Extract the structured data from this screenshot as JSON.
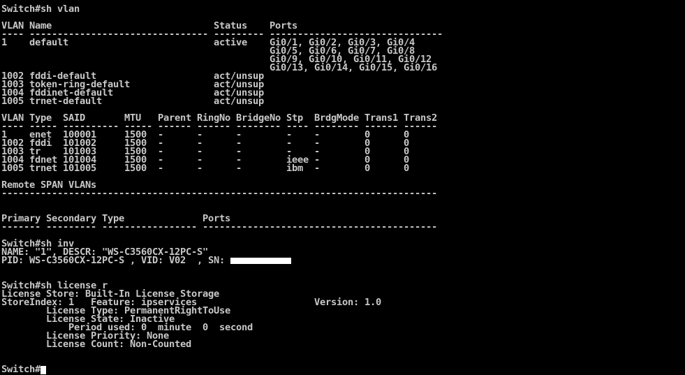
{
  "terminal": {
    "lines": [
      "Switch#sh vlan",
      "",
      "VLAN Name                             Status    Ports",
      "---- -------------------------------- --------- -------------------------------",
      "1    default                          active    Gi0/1, Gi0/2, Gi0/3, Gi0/4",
      "                                                Gi0/5, Gi0/6, Gi0/7, Gi0/8",
      "                                                Gi0/9, Gi0/10, Gi0/11, Gi0/12",
      "                                                Gi0/13, Gi0/14, Gi0/15, Gi0/16",
      "1002 fddi-default                     act/unsup",
      "1003 token-ring-default               act/unsup",
      "1004 fddinet-default                  act/unsup",
      "1005 trnet-default                    act/unsup",
      "",
      "VLAN Type  SAID       MTU   Parent RingNo BridgeNo Stp  BrdgMode Trans1 Trans2",
      "---- ----- ---------- ----- ------ ------ -------- ---- -------- ------ ------",
      "1    enet  100001     1500  -      -      -        -    -        0      0",
      "1002 fddi  101002     1500  -      -      -        -    -        0      0",
      "1003 tr    101003     1500  -      -      -        -    -        0      0",
      "1004 fdnet 101004     1500  -      -      -        ieee -        0      0",
      "1005 trnet 101005     1500  -      -      -        ibm  -        0      0",
      "",
      "Remote SPAN VLANs",
      "------------------------------------------------------------------------------",
      "",
      "",
      "Primary Secondary Type              Ports",
      "------- --------- ----------------- ------------------------------------------",
      "",
      "Switch#sh inv",
      "NAME: \"1\", DESCR: \"WS-C3560CX-12PC-S\"",
      "PID: WS-C3560CX-12PC-S , VID: V02  , SN:",
      "",
      "",
      "Switch#sh license r",
      "License Store: Built-In License Storage",
      "StoreIndex: 1   Feature: ipservices                     Version: 1.0",
      "        License Type: PermanentRightToUse",
      "        License State: Inactive",
      "            Period used: 0  minute  0  second",
      "        License Priority: None",
      "        License Count: Non-Counted",
      "",
      "",
      "Switch#"
    ]
  }
}
